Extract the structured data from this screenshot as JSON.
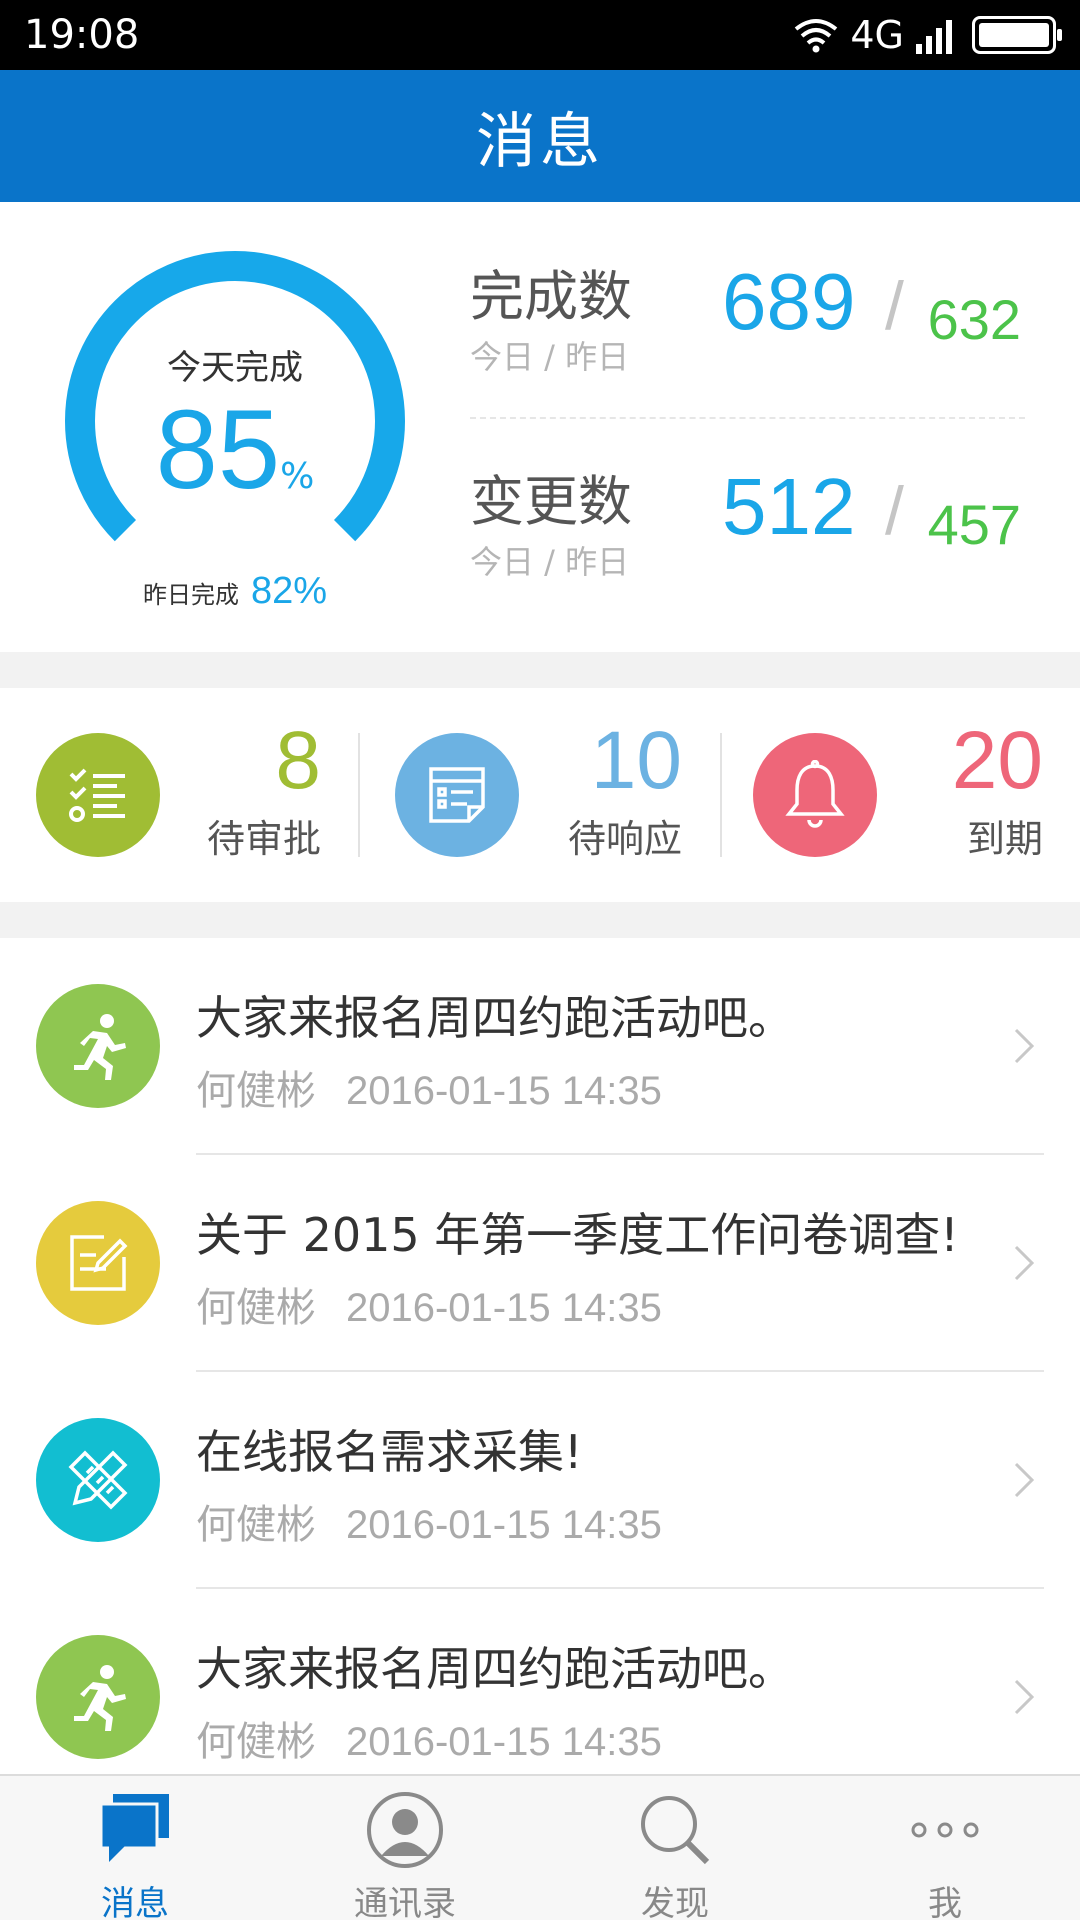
{
  "status_bar": {
    "time": "19:08",
    "network": "4G",
    "battery_level": 1.0
  },
  "header": {
    "title": "消息"
  },
  "stats": {
    "today_completion": {
      "label": "今天完成",
      "value": "85",
      "unit": "%",
      "fraction": 0.85
    },
    "yesterday_completion": {
      "label": "昨日完成",
      "value": "82%"
    },
    "completed": {
      "title": "完成数",
      "subtitle": "今日 / 昨日",
      "today": "689",
      "slash": "/",
      "yesterday": "632"
    },
    "changed": {
      "title": "变更数",
      "subtitle": "今日 / 昨日",
      "today": "512",
      "slash": "/",
      "yesterday": "457"
    }
  },
  "quick": {
    "pending_approval": {
      "count": "8",
      "label": "待审批",
      "color": "#a0bd34"
    },
    "pending_response": {
      "count": "10",
      "label": "待响应",
      "color": "#6cb2e2"
    },
    "expiring": {
      "count": "20",
      "label": "到期",
      "color": "#ee6679"
    }
  },
  "messages": [
    {
      "title": "大家来报名周四约跑活动吧。",
      "author": "何健彬",
      "time": "2016-01-15 14:35",
      "icon": "running-icon",
      "color": "#8fc651"
    },
    {
      "title": "关于 2015 年第一季度工作问卷调查!",
      "author": "何健彬",
      "time": "2016-01-15 14:35",
      "icon": "survey-edit-icon",
      "color": "#e5cb3d"
    },
    {
      "title": "在线报名需求采集!",
      "author": "何健彬",
      "time": "2016-01-15 14:35",
      "icon": "pencil-ruler-icon",
      "color": "#12bed1"
    },
    {
      "title": "大家来报名周四约跑活动吧。",
      "author": "何健彬",
      "time": "2016-01-15 14:35",
      "icon": "running-icon",
      "color": "#8fc651"
    }
  ],
  "tabs": [
    {
      "label": "消息",
      "icon": "chat-bubbles-icon",
      "active": true
    },
    {
      "label": "通讯录",
      "icon": "contacts-icon",
      "active": false
    },
    {
      "label": "发现",
      "icon": "search-icon",
      "active": false
    },
    {
      "label": "我",
      "icon": "more-dots-icon",
      "active": false
    }
  ],
  "colors": {
    "primary": "#0a74c9",
    "accent_blue": "#1aa6e8",
    "accent_green": "#4cc34a"
  }
}
